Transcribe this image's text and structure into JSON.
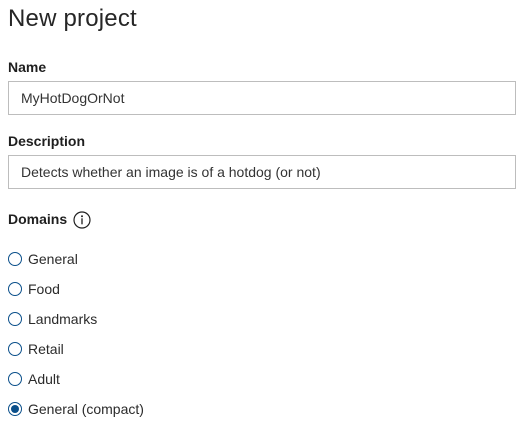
{
  "page": {
    "title": "New project"
  },
  "name_field": {
    "label": "Name",
    "value": "MyHotDogOrNot"
  },
  "description_field": {
    "label": "Description",
    "value": "Detects whether an image is of a hotdog (or not)"
  },
  "domains": {
    "label": "Domains",
    "info_icon": "info-icon",
    "options": [
      {
        "label": "General",
        "checked": false
      },
      {
        "label": "Food",
        "checked": false
      },
      {
        "label": "Landmarks",
        "checked": false
      },
      {
        "label": "Retail",
        "checked": false
      },
      {
        "label": "Adult",
        "checked": false
      },
      {
        "label": "General (compact)",
        "checked": true
      }
    ],
    "selected": "General (compact)"
  },
  "colors": {
    "accent": "#0a4f8a",
    "input_border": "#bdbdbd",
    "text": "#1f1f1f"
  }
}
